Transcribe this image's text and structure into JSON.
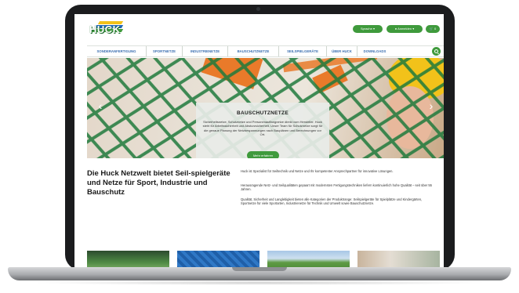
{
  "site": {
    "logo_text": "HUCK",
    "colors": {
      "brand_green": "#3f9a3c",
      "nav_blue": "#3b6fb0",
      "logo_blue": "#1f66b7",
      "logo_yellow": "#f2c21a"
    },
    "header": {
      "language_label": "Sprache",
      "login_label": "Anmelden",
      "cart_label": "0"
    },
    "nav": [
      "SONDERANFERTIGUNG",
      "SPORTNETZE",
      "INDUSTRIENETZE",
      "BAUSCHUTZNETZE",
      "SEILSPIELGERÄTE",
      "ÜBER HUCK",
      "DOWNLOADS"
    ],
    "search_icon": "search-icon",
    "hero": {
      "title": "BAUSCHUTZNETZE",
      "text": "Sicherheitsnetze, Schutznetze und Personenauffangnetze direkt vom Hersteller. Huck steht für Arbeitssicherheit und Absturzsicherheit. Unser Team für Schutznetze sorgt für die genaue Planung der Netzbespannungen nach Bauplänen und Berechnungen vor Ort.",
      "button": "Mehr erfahren"
    },
    "intro": {
      "heading": "Die Huck Netzwelt bietet Seil-spielgeräte und Netze für Sport, Industrie und Bauschutz",
      "p1": "Huck ist Spezialist für Seiltechnik und Netze und Ihr kompetenter Ansprechpartner für innovative Lösungen.",
      "p2": "Herausragende Netz- und Seilqualitäten gepaart mit modernsten Fertigungstechniken liefern kontinuierlich hohe Qualität – seit über 55 Jahren.",
      "p3": "Qualität, Sicherheit und Langlebigkeit bieten alle Kategorien der Produktrange: Seilspielgeräte für Spielplätze und Kindergärten, Sportnetze für viele Sportarten, Industrienetze für Technik und Umwelt sowie Bauschutznetze."
    }
  }
}
